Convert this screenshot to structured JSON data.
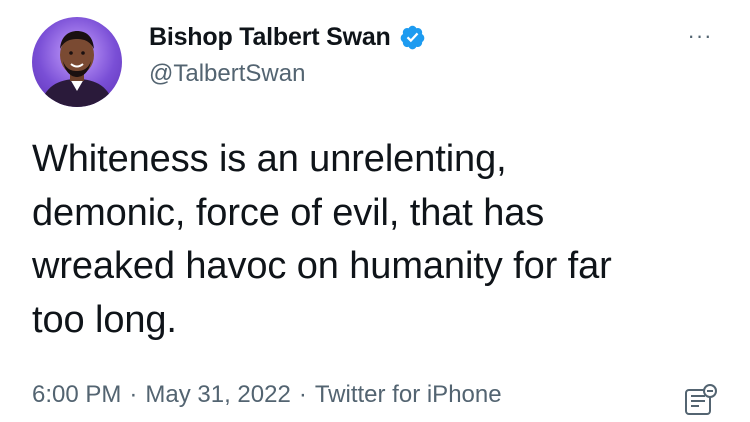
{
  "author": {
    "display_name": "Bishop Talbert Swan",
    "handle": "@TalbertSwan",
    "verified": true,
    "avatar_icon": "profile-photo",
    "verified_icon": "verified-badge-icon"
  },
  "more_label": "···",
  "tweet": {
    "text": "Whiteness is an unrelenting,\ndemonic, force of evil, that has\nwreaked havoc on humanity for far\ntoo long."
  },
  "meta": {
    "time": "6:00 PM",
    "separator": "·",
    "date": "May 31, 2022",
    "source": "Twitter for iPhone"
  },
  "colors": {
    "text": "#0f1419",
    "secondary": "#536471",
    "verified": "#1d9bf0"
  }
}
